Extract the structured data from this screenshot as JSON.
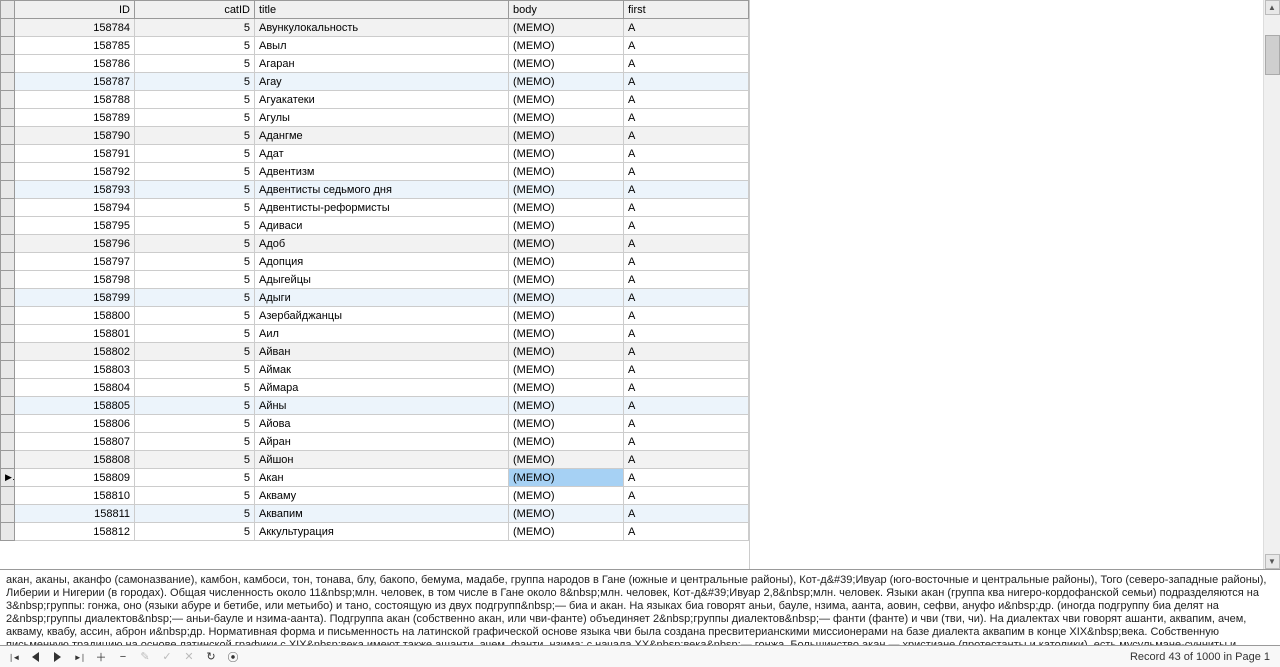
{
  "columns": [
    "ID",
    "catID",
    "title",
    "body",
    "first"
  ],
  "rows": [
    {
      "id": "158784",
      "cat": "5",
      "title": "Авункулокальность",
      "body": "(MEMO)",
      "first": "А",
      "style": "shade"
    },
    {
      "id": "158785",
      "cat": "5",
      "title": "Авыл",
      "body": "(MEMO)",
      "first": "А",
      "style": ""
    },
    {
      "id": "158786",
      "cat": "5",
      "title": "Агаран",
      "body": "(MEMO)",
      "first": "А",
      "style": ""
    },
    {
      "id": "158787",
      "cat": "5",
      "title": "Агау",
      "body": "(MEMO)",
      "first": "А",
      "style": "blue"
    },
    {
      "id": "158788",
      "cat": "5",
      "title": "Агуакатеки",
      "body": "(MEMO)",
      "first": "А",
      "style": ""
    },
    {
      "id": "158789",
      "cat": "5",
      "title": "Агулы",
      "body": "(MEMO)",
      "first": "А",
      "style": ""
    },
    {
      "id": "158790",
      "cat": "5",
      "title": "Адангме",
      "body": "(MEMO)",
      "first": "А",
      "style": "shade"
    },
    {
      "id": "158791",
      "cat": "5",
      "title": "Адат",
      "body": "(MEMO)",
      "first": "А",
      "style": ""
    },
    {
      "id": "158792",
      "cat": "5",
      "title": "Адвентизм",
      "body": "(MEMO)",
      "first": "А",
      "style": ""
    },
    {
      "id": "158793",
      "cat": "5",
      "title": "Адвентисты седьмого дня",
      "body": "(MEMO)",
      "first": "А",
      "style": "blue"
    },
    {
      "id": "158794",
      "cat": "5",
      "title": "Адвентисты-реформисты",
      "body": "(MEMO)",
      "first": "А",
      "style": ""
    },
    {
      "id": "158795",
      "cat": "5",
      "title": "Адиваси",
      "body": "(MEMO)",
      "first": "А",
      "style": ""
    },
    {
      "id": "158796",
      "cat": "5",
      "title": "Адоб",
      "body": "(MEMO)",
      "first": "А",
      "style": "shade"
    },
    {
      "id": "158797",
      "cat": "5",
      "title": "Адопция",
      "body": "(MEMO)",
      "first": "А",
      "style": ""
    },
    {
      "id": "158798",
      "cat": "5",
      "title": "Адыгейцы",
      "body": "(MEMO)",
      "first": "А",
      "style": ""
    },
    {
      "id": "158799",
      "cat": "5",
      "title": "Адыги",
      "body": "(MEMO)",
      "first": "А",
      "style": "blue"
    },
    {
      "id": "158800",
      "cat": "5",
      "title": "Азербайджанцы",
      "body": "(MEMO)",
      "first": "А",
      "style": ""
    },
    {
      "id": "158801",
      "cat": "5",
      "title": "Аил",
      "body": "(MEMO)",
      "first": "А",
      "style": ""
    },
    {
      "id": "158802",
      "cat": "5",
      "title": "Айван",
      "body": "(MEMO)",
      "first": "А",
      "style": "shade"
    },
    {
      "id": "158803",
      "cat": "5",
      "title": "Аймак",
      "body": "(MEMO)",
      "first": "А",
      "style": ""
    },
    {
      "id": "158804",
      "cat": "5",
      "title": "Аймара",
      "body": "(MEMO)",
      "first": "А",
      "style": ""
    },
    {
      "id": "158805",
      "cat": "5",
      "title": "Айны",
      "body": "(MEMO)",
      "first": "А",
      "style": "blue"
    },
    {
      "id": "158806",
      "cat": "5",
      "title": "Айова",
      "body": "(MEMO)",
      "first": "А",
      "style": ""
    },
    {
      "id": "158807",
      "cat": "5",
      "title": "Айран",
      "body": "(MEMO)",
      "first": "А",
      "style": ""
    },
    {
      "id": "158808",
      "cat": "5",
      "title": "Айшон",
      "body": "(MEMO)",
      "first": "А",
      "style": "shade"
    },
    {
      "id": "158809",
      "cat": "5",
      "title": "Акан",
      "body": "(MEMO)",
      "first": "А",
      "style": "",
      "current": true
    },
    {
      "id": "158810",
      "cat": "5",
      "title": "Акваму",
      "body": "(MEMO)",
      "first": "А",
      "style": ""
    },
    {
      "id": "158811",
      "cat": "5",
      "title": "Аквапим",
      "body": "(MEMO)",
      "first": "А",
      "style": "blue"
    },
    {
      "id": "158812",
      "cat": "5",
      "title": "Аккультурация",
      "body": "(MEMO)",
      "first": "А",
      "style": ""
    }
  ],
  "detail_text": "акан, аканы, аканфо (самоназвание), камбон, камбоси, тон, тонава, блу, бакопо, бемума, мадабе, группа народов в Гане (южные и центральные районы), Кот-д&#39;Ивуар (юго-восточные и центральные районы), Того (северо-западные районы), Либерии и Нигерии (в городах). Общая численность около 11&nbsp;млн. человек, в том числе в Гане около 8&nbsp;млн. человек, Кот-д&#39;Ивуар 2,8&nbsp;млн. человек. Языки акан (группа ква нигеро-кордофанской семьи) подразделяются на 3&nbsp;группы: гонжа, оно (языки абуре и бетибе, или метьибо) и тано, состоящую из двух подгрупп&nbsp;— биа и акан. На языках биа говорят аньи, бауле, нзима, аанта, аовин, сефви, ануфо и&nbsp;др. (иногда подгруппу биа делят на 2&nbsp;группы диалектов&nbsp;— аньи-бауле и нзима-аанта). Подгруппа акан (собственно акан, или чви-фанте) объединяет 2&nbsp;группы диалектов&nbsp;— фанти (фанте) и чви (тви, чи). На диалектах чви говорят ашанти, аквапим, ачем, акваму, квабу, ассин, аброн и&nbsp;др. Нормативная форма и письменность на латинской графической основе языка чви была создана пресвитерианскими миссионерами на базе диалекта аквапим в конце XIX&nbsp;века. Собственную письменную традицию на основе латинской графики с XIX&nbsp;века имеют также ашанти, ачем, фанти, нзима; с начала XX&nbsp;века&nbsp;— гонжа. Большинство акан — христиане (протестанты и католики), есть мусульмане-сунниты и приверженцы христианско-африканских церквей и сект, значительная часть придерживается традиционных верований. Древнейших предков акан обычно связывают с населением древней Ганы, хотя",
  "nav": {
    "plus": "＋",
    "minus": "−",
    "check": "✓",
    "cancel": "✕",
    "edit": "✎",
    "refresh": "↻",
    "bookmark": "⦿"
  },
  "status": "Record 43 of 1000 in Page 1"
}
